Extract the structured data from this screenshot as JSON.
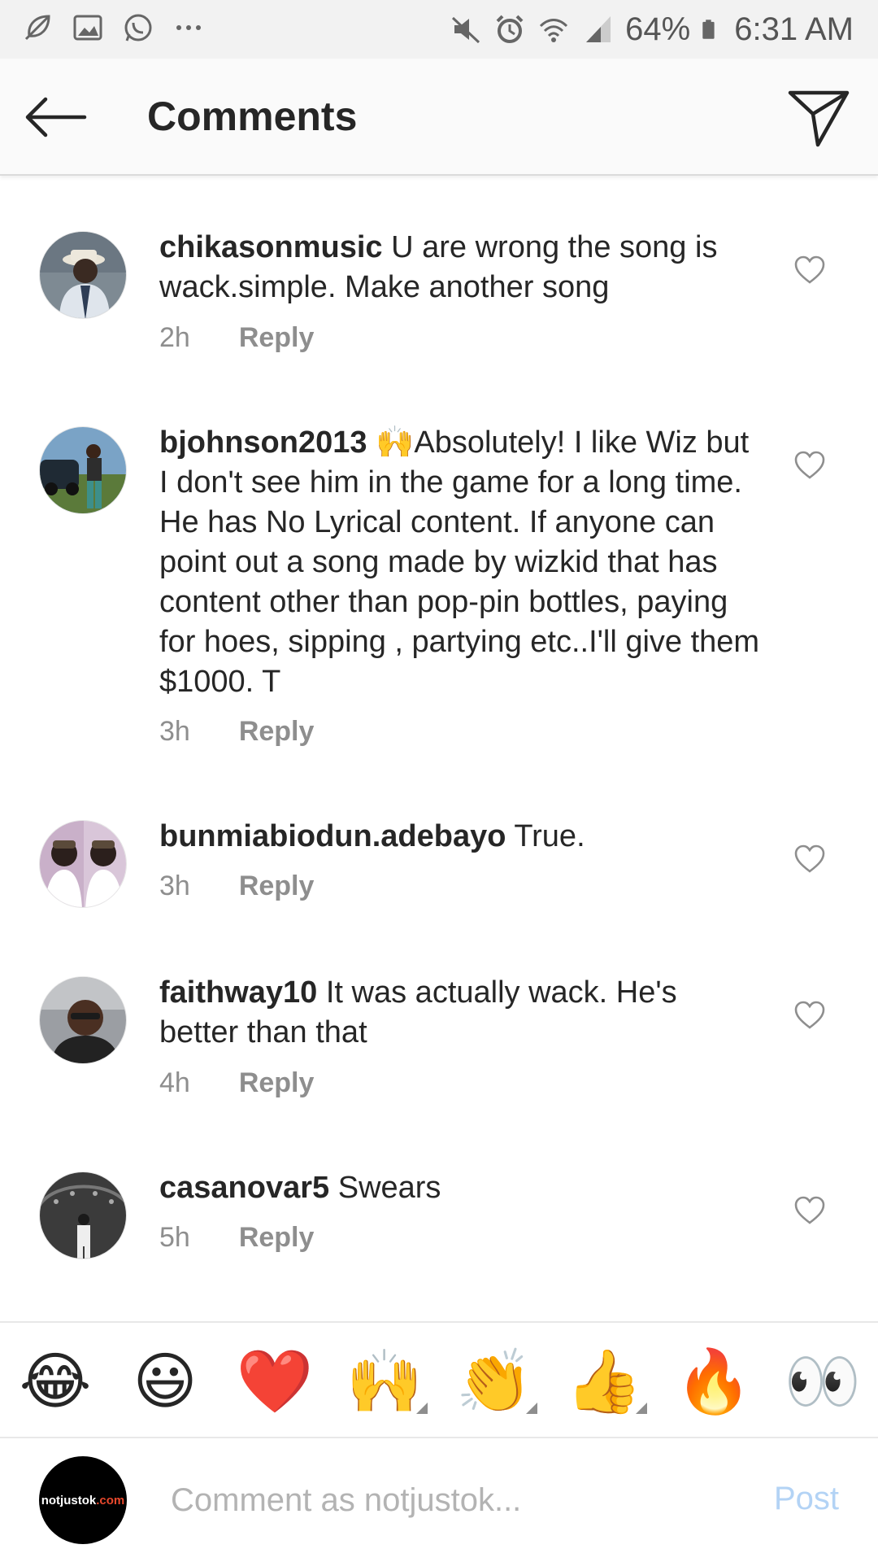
{
  "status_bar": {
    "battery": "64%",
    "time": "6:31 AM",
    "left_icons": [
      "leaf-icon",
      "image-icon",
      "whatsapp-icon",
      "more-dots-icon"
    ],
    "right_icons": [
      "mute-icon",
      "alarm-icon",
      "wifi-icon",
      "signal-icon",
      "battery-icon"
    ]
  },
  "header": {
    "title": "Comments"
  },
  "comments": [
    {
      "username": "chikasonmusic",
      "text": "U are wrong the song is wack.simple. Make another song",
      "time": "2h",
      "reply": "Reply"
    },
    {
      "username": "bjohnson2013",
      "text": "🙌Absolutely! I like Wiz but I don't see him in the game for a long time. He has No Lyrical content. If anyone can point out a song made by wizkid that has content other than pop-pin bottles, paying for hoes, sipping , partying etc..I'll give them $1000. T",
      "time": "3h",
      "reply": "Reply"
    },
    {
      "username": "bunmiabiodun.adebayo",
      "text": "True.",
      "time": "3h",
      "reply": "Reply"
    },
    {
      "username": "faithway10",
      "text": "It was actually wack.  He's better than that",
      "time": "4h",
      "reply": "Reply"
    },
    {
      "username": "casanovar5",
      "text": "Swears",
      "time": "5h",
      "reply": "Reply"
    }
  ],
  "emoji_bar": [
    "😂",
    "😃",
    "❤️",
    "🙌",
    "👏",
    "👍",
    "🔥",
    "👀"
  ],
  "input": {
    "placeholder": "Comment as notjustok...",
    "post_label": "Post",
    "avatar_text": "notjustok",
    "avatar_suffix": ".com"
  },
  "colors": {
    "text": "#262626",
    "secondary": "#8e8e8e",
    "post_disabled": "#b3d3f5",
    "heart_outline": "#8e8e8e"
  }
}
